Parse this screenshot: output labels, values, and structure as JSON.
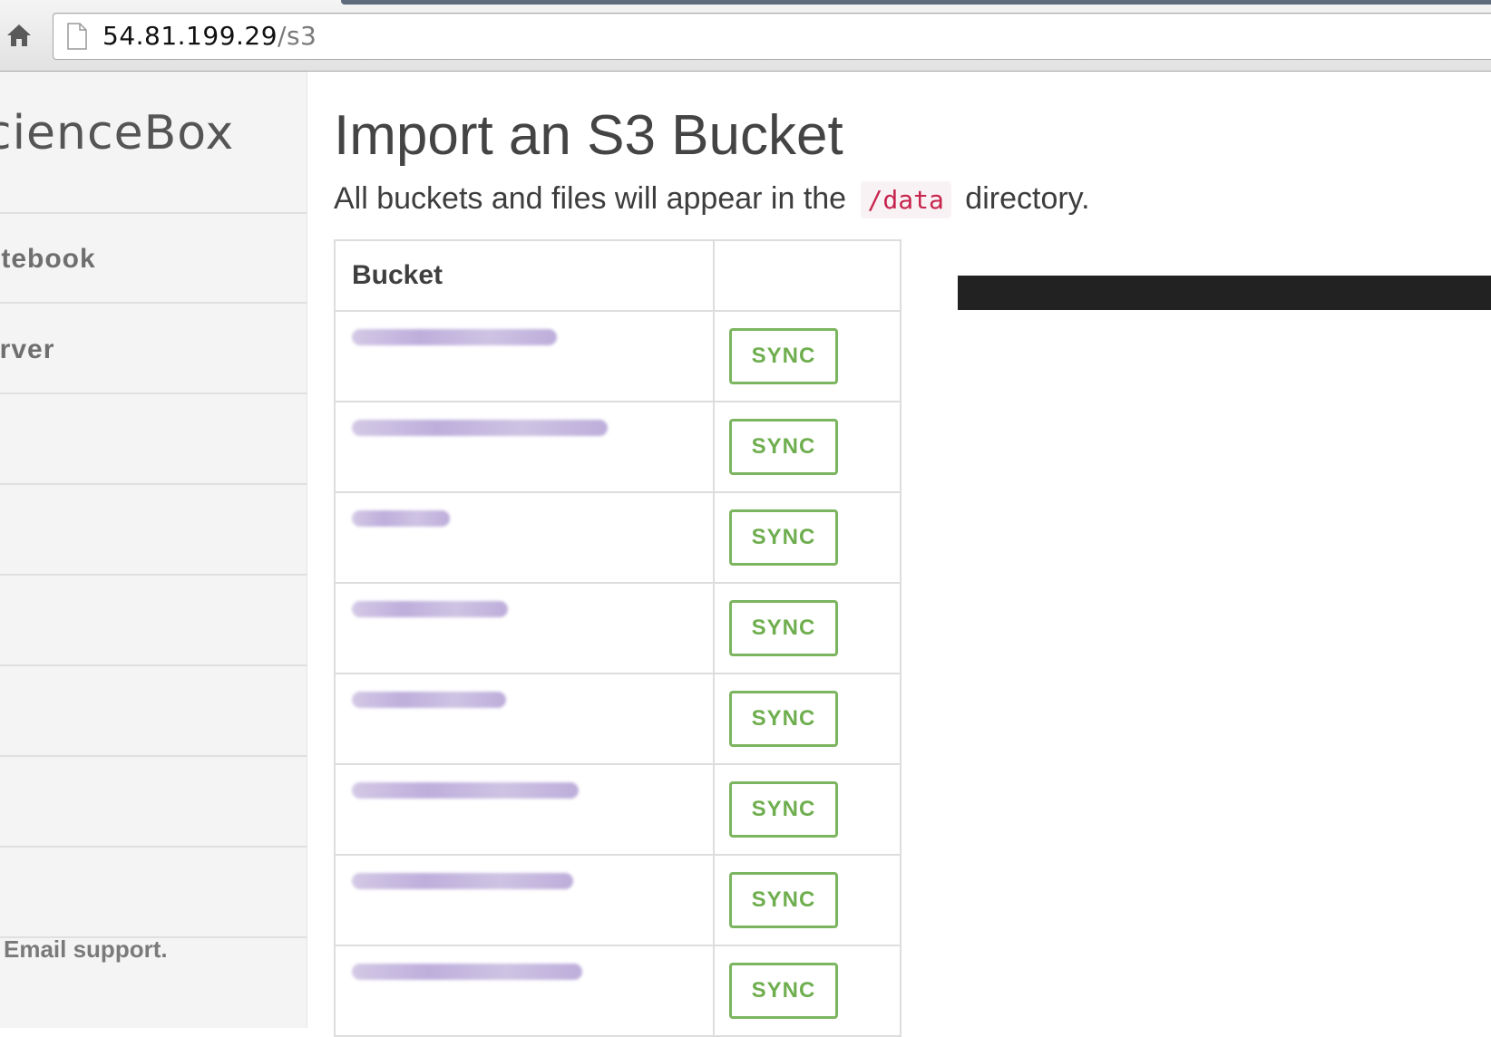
{
  "browser": {
    "url_host": "54.81.199.29",
    "url_path": "/s3",
    "home_icon": "home-icon",
    "page_icon": "document-icon"
  },
  "sidebar": {
    "brand": "cienceBox",
    "items": [
      {
        "label": "otebook"
      },
      {
        "label": "erver"
      },
      {
        "label": ""
      },
      {
        "label": ""
      },
      {
        "label": ""
      },
      {
        "label": ""
      },
      {
        "label": ""
      },
      {
        "label": ""
      }
    ],
    "support": "Email support."
  },
  "main": {
    "title": "Import an S3 Bucket",
    "subtitle_pre": "All buckets and files will appear in the",
    "subtitle_code": "/data",
    "subtitle_post": "directory.",
    "table": {
      "headers": [
        "Bucket",
        ""
      ],
      "rows": [
        {
          "name": "",
          "action": "SYNC"
        },
        {
          "name": "",
          "action": "SYNC"
        },
        {
          "name": "",
          "action": "SYNC"
        },
        {
          "name": "",
          "action": "SYNC"
        },
        {
          "name": "",
          "action": "SYNC"
        },
        {
          "name": "",
          "action": "SYNC"
        },
        {
          "name": "",
          "action": "SYNC"
        },
        {
          "name": "",
          "action": "SYNC"
        }
      ]
    }
  },
  "colors": {
    "accent_green": "#7cb55f",
    "code_red": "#c7254e",
    "redaction_purple": "#b7a6d8"
  }
}
